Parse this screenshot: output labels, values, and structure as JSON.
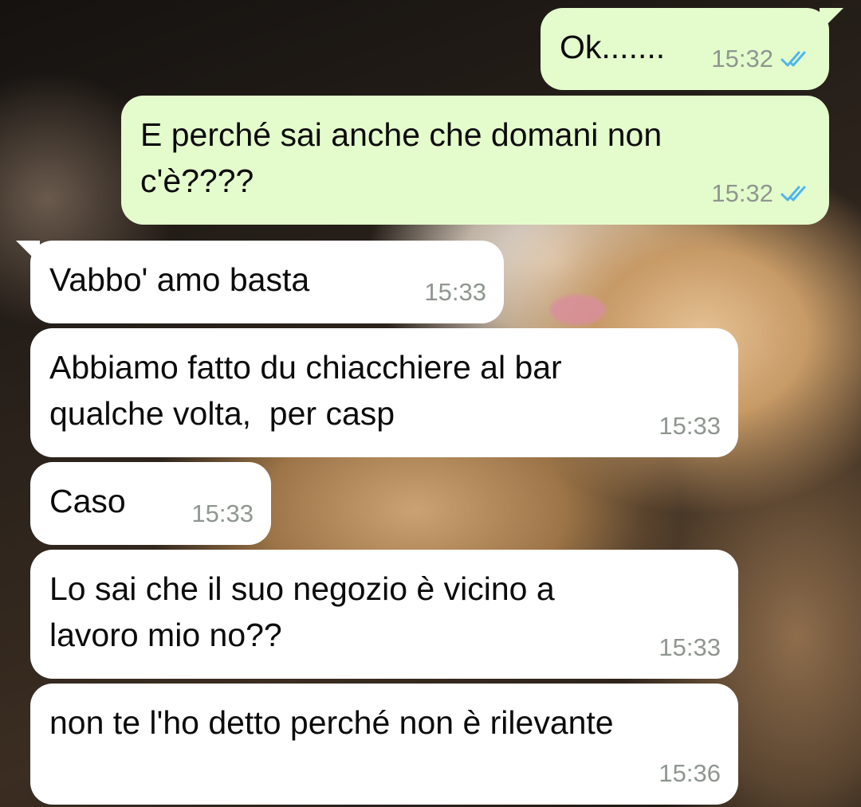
{
  "chat": {
    "messages": [
      {
        "direction": "outgoing",
        "text": "Ok.......",
        "time": "15:32",
        "status_icon": "double-check-read-icon"
      },
      {
        "direction": "outgoing",
        "text": "E perché sai anche che domani non\nc'è????",
        "time": "15:32",
        "status_icon": "double-check-read-icon"
      },
      {
        "direction": "incoming",
        "text": "Vabbo' amo basta",
        "time": "15:33"
      },
      {
        "direction": "incoming",
        "text": "Abbiamo fatto du chiacchiere al bar\nqualche volta,  per casp",
        "time": "15:33"
      },
      {
        "direction": "incoming",
        "text": "Caso",
        "time": "15:33"
      },
      {
        "direction": "incoming",
        "text": "Lo sai che il suo negozio è vicino a\nlavoro mio no??",
        "time": "15:33"
      },
      {
        "direction": "incoming",
        "text": "non te l'ho detto perché non è rilevante",
        "time": "15:36"
      }
    ]
  },
  "colors": {
    "outgoing_bubble": "#e4fccc",
    "incoming_bubble": "#ffffff",
    "read_ticks": "#4fb6ec",
    "timestamp": "#8f9690"
  }
}
